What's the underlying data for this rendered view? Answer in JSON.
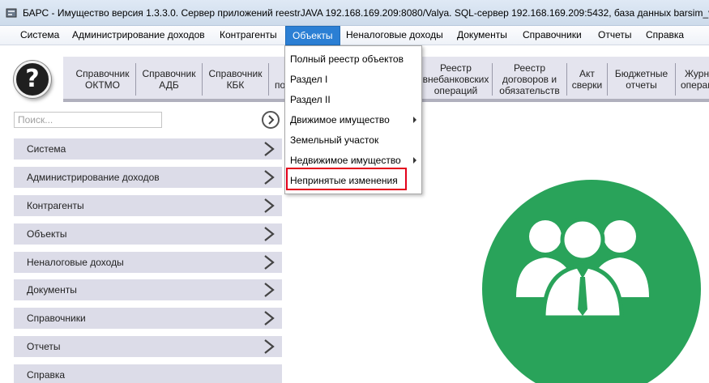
{
  "window": {
    "title": "БАРС - Имущество версия 1.3.3.0. Сервер приложений reestrJAVA 192.168.169.209:8080/Valya. SQL-сервер 192.168.169.209:5432, база данных barsim_valya"
  },
  "menubar": {
    "items": [
      {
        "label": "Система"
      },
      {
        "label": "Администрирование доходов"
      },
      {
        "label": "Контрагенты"
      },
      {
        "label": "Объекты",
        "active": true
      },
      {
        "label": "Неналоговые доходы"
      },
      {
        "label": "Документы"
      },
      {
        "label": "Справочники"
      },
      {
        "label": "Отчеты"
      },
      {
        "label": "Справка"
      }
    ]
  },
  "help": {
    "symbol": "?"
  },
  "toolbar": {
    "buttons": [
      {
        "label": "Справочник\nОКТМО"
      },
      {
        "label": "Справочник\nАДБ"
      },
      {
        "label": "Справочник\nКБК"
      },
      {
        "label": "по"
      },
      {
        "label": "Реестр\nвнебанковских\nопераций"
      },
      {
        "label": "Реестр\nдоговоров и\nобязательств"
      },
      {
        "label": "Акт\nсверки"
      },
      {
        "label": "Бюджетные\nотчеты"
      },
      {
        "label": "Журн\nоперац"
      }
    ]
  },
  "search": {
    "placeholder": "Поиск..."
  },
  "sidebar": {
    "items": [
      {
        "label": "Система"
      },
      {
        "label": "Администрирование доходов"
      },
      {
        "label": "Контрагенты"
      },
      {
        "label": "Объекты"
      },
      {
        "label": "Неналоговые доходы"
      },
      {
        "label": "Документы"
      },
      {
        "label": "Справочники"
      },
      {
        "label": "Отчеты"
      },
      {
        "label": "Справка"
      }
    ]
  },
  "dropdown": {
    "items": [
      {
        "label": "Полный реестр объектов",
        "submenu": false
      },
      {
        "label": "Раздел I",
        "submenu": false
      },
      {
        "label": "Раздел II",
        "submenu": false
      },
      {
        "label": "Движимое имущество",
        "submenu": true
      },
      {
        "label": "Земельный участок",
        "submenu": false
      },
      {
        "label": "Недвижимое имущество",
        "submenu": true
      },
      {
        "label": "Непринятые изменения",
        "submenu": false,
        "highlighted": true
      }
    ]
  },
  "colors": {
    "accent": "#2b7fd4",
    "highlight_border": "#e3001b",
    "logo_green": "#29a35a",
    "sidebar_bg": "#dcdce8"
  }
}
